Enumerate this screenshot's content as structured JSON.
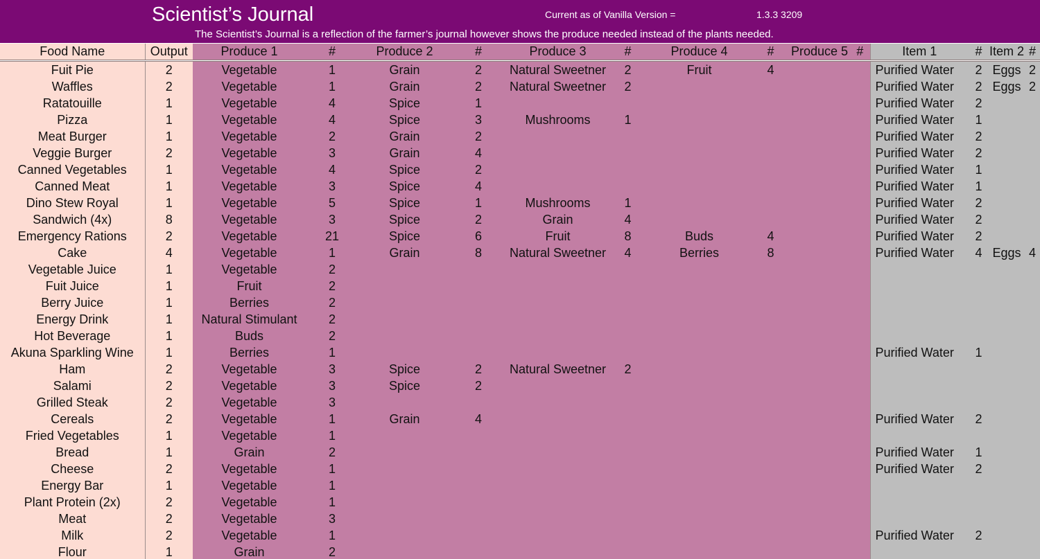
{
  "header": {
    "title": "Scientist’s Journal",
    "version_label": "Current as of Vanilla Version =",
    "version_value": "1.3.3 3209",
    "subtitle": "The Scientist’s Journal is a reflection of the farmer’s journal however shows the produce needed instead of the plants needed."
  },
  "columns": [
    "Food Name",
    "Output",
    "Produce 1",
    "#",
    "Produce 2",
    "#",
    "Produce 3",
    "#",
    "Produce 4",
    "#",
    "Produce 5",
    "#",
    "Item 1",
    "#",
    "Item 2",
    "#"
  ],
  "rows": [
    [
      "Fuit Pie",
      "2",
      "Vegetable",
      "1",
      "Grain",
      "2",
      "Natural Sweetner",
      "2",
      "Fruit",
      "4",
      "",
      "",
      "Purified Water",
      "2",
      "Eggs",
      "2"
    ],
    [
      "Waffles",
      "2",
      "Vegetable",
      "1",
      "Grain",
      "2",
      "Natural Sweetner",
      "2",
      "",
      "",
      "",
      "",
      "Purified Water",
      "2",
      "Eggs",
      "2"
    ],
    [
      "Ratatouille",
      "1",
      "Vegetable",
      "4",
      "Spice",
      "1",
      "",
      "",
      "",
      "",
      "",
      "",
      "Purified Water",
      "2",
      "",
      ""
    ],
    [
      "Pizza",
      "1",
      "Vegetable",
      "4",
      "Spice",
      "3",
      "Mushrooms",
      "1",
      "",
      "",
      "",
      "",
      "Purified Water",
      "1",
      "",
      ""
    ],
    [
      "Meat Burger",
      "1",
      "Vegetable",
      "2",
      "Grain",
      "2",
      "",
      "",
      "",
      "",
      "",
      "",
      "Purified Water",
      "2",
      "",
      ""
    ],
    [
      "Veggie Burger",
      "2",
      "Vegetable",
      "3",
      "Grain",
      "4",
      "",
      "",
      "",
      "",
      "",
      "",
      "Purified Water",
      "2",
      "",
      ""
    ],
    [
      "Canned Vegetables",
      "1",
      "Vegetable",
      "4",
      "Spice",
      "2",
      "",
      "",
      "",
      "",
      "",
      "",
      "Purified Water",
      "1",
      "",
      ""
    ],
    [
      "Canned Meat",
      "1",
      "Vegetable",
      "3",
      "Spice",
      "4",
      "",
      "",
      "",
      "",
      "",
      "",
      "Purified Water",
      "1",
      "",
      ""
    ],
    [
      "Dino Stew Royal",
      "1",
      "Vegetable",
      "5",
      "Spice",
      "1",
      "Mushrooms",
      "1",
      "",
      "",
      "",
      "",
      "Purified Water",
      "2",
      "",
      ""
    ],
    [
      "Sandwich (4x)",
      "8",
      "Vegetable",
      "3",
      "Spice",
      "2",
      "Grain",
      "4",
      "",
      "",
      "",
      "",
      "Purified Water",
      "2",
      "",
      ""
    ],
    [
      "Emergency Rations",
      "2",
      "Vegetable",
      "21",
      "Spice",
      "6",
      "Fruit",
      "8",
      "Buds",
      "4",
      "",
      "",
      "Purified Water",
      "2",
      "",
      ""
    ],
    [
      "Cake",
      "4",
      "Vegetable",
      "1",
      "Grain",
      "8",
      "Natural Sweetner",
      "4",
      "Berries",
      "8",
      "",
      "",
      "Purified Water",
      "4",
      "Eggs",
      "4"
    ],
    [
      "Vegetable Juice",
      "1",
      "Vegetable",
      "2",
      "",
      "",
      "",
      "",
      "",
      "",
      "",
      "",
      "",
      "",
      "",
      ""
    ],
    [
      "Fuit Juice",
      "1",
      "Fruit",
      "2",
      "",
      "",
      "",
      "",
      "",
      "",
      "",
      "",
      "",
      "",
      "",
      ""
    ],
    [
      "Berry Juice",
      "1",
      "Berries",
      "2",
      "",
      "",
      "",
      "",
      "",
      "",
      "",
      "",
      "",
      "",
      "",
      ""
    ],
    [
      "Energy Drink",
      "1",
      "Natural Stimulant",
      "2",
      "",
      "",
      "",
      "",
      "",
      "",
      "",
      "",
      "",
      "",
      "",
      ""
    ],
    [
      "Hot Beverage",
      "1",
      "Buds",
      "2",
      "",
      "",
      "",
      "",
      "",
      "",
      "",
      "",
      "",
      "",
      "",
      ""
    ],
    [
      "Akuna Sparkling Wine",
      "1",
      "Berries",
      "1",
      "",
      "",
      "",
      "",
      "",
      "",
      "",
      "",
      "Purified Water",
      "1",
      "",
      ""
    ],
    [
      "Ham",
      "2",
      "Vegetable",
      "3",
      "Spice",
      "2",
      "Natural Sweetner",
      "2",
      "",
      "",
      "",
      "",
      "",
      "",
      "",
      ""
    ],
    [
      "Salami",
      "2",
      "Vegetable",
      "3",
      "Spice",
      "2",
      "",
      "",
      "",
      "",
      "",
      "",
      "",
      "",
      "",
      ""
    ],
    [
      "Grilled Steak",
      "2",
      "Vegetable",
      "3",
      "",
      "",
      "",
      "",
      "",
      "",
      "",
      "",
      "",
      "",
      "",
      ""
    ],
    [
      "Cereals",
      "2",
      "Vegetable",
      "1",
      "Grain",
      "4",
      "",
      "",
      "",
      "",
      "",
      "",
      "Purified Water",
      "2",
      "",
      ""
    ],
    [
      "Fried Vegetables",
      "1",
      "Vegetable",
      "1",
      "",
      "",
      "",
      "",
      "",
      "",
      "",
      "",
      "",
      "",
      "",
      ""
    ],
    [
      "Bread",
      "1",
      "Grain",
      "2",
      "",
      "",
      "",
      "",
      "",
      "",
      "",
      "",
      "Purified Water",
      "1",
      "",
      ""
    ],
    [
      "Cheese",
      "2",
      "Vegetable",
      "1",
      "",
      "",
      "",
      "",
      "",
      "",
      "",
      "",
      "Purified Water",
      "2",
      "",
      ""
    ],
    [
      "Energy Bar",
      "1",
      "Vegetable",
      "1",
      "",
      "",
      "",
      "",
      "",
      "",
      "",
      "",
      "",
      "",
      "",
      ""
    ],
    [
      "Plant Protein (2x)",
      "2",
      "Vegetable",
      "1",
      "",
      "",
      "",
      "",
      "",
      "",
      "",
      "",
      "",
      "",
      "",
      ""
    ],
    [
      "Meat",
      "2",
      "Vegetable",
      "3",
      "",
      "",
      "",
      "",
      "",
      "",
      "",
      "",
      "",
      "",
      "",
      ""
    ],
    [
      "Milk",
      "2",
      "Vegetable",
      "1",
      "",
      "",
      "",
      "",
      "",
      "",
      "",
      "",
      "Purified Water",
      "2",
      "",
      ""
    ],
    [
      "Flour",
      "1",
      "Grain",
      "2",
      "",
      "",
      "",
      "",
      "",
      "",
      "",
      "",
      "",
      "",
      "",
      ""
    ]
  ]
}
